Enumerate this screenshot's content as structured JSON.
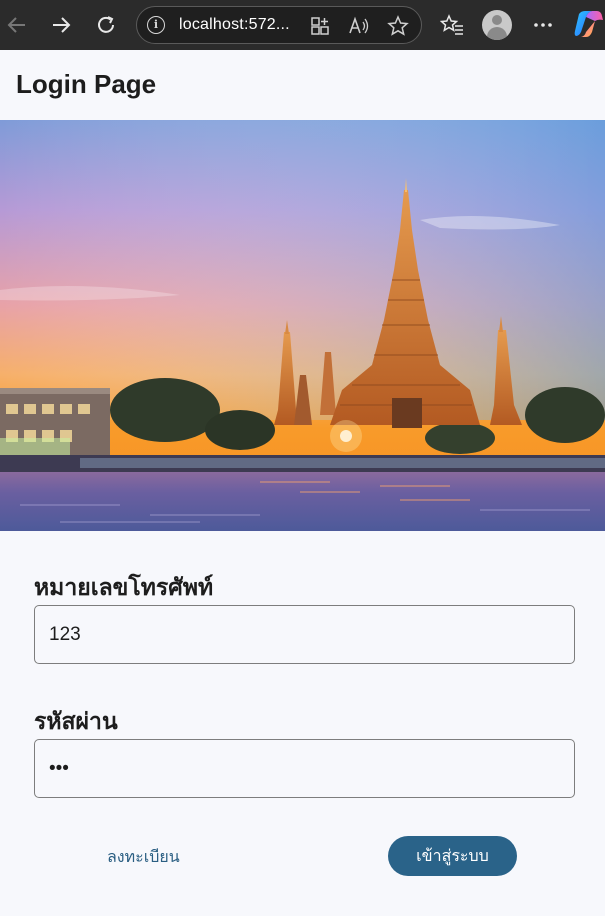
{
  "browser": {
    "url": "localhost:572...",
    "icons": [
      "back-icon",
      "forward-icon",
      "refresh-icon",
      "info-icon",
      "app-available-icon",
      "read-aloud-icon",
      "favorite-star-icon",
      "favorites-icon",
      "profile-avatar",
      "more-icon",
      "copilot-icon"
    ]
  },
  "app": {
    "title": "Login Page"
  },
  "hero": {
    "image": "wat-arun-temple-sunset-photo"
  },
  "form": {
    "phone_label": "หมายเลขโทรศัพท์",
    "phone_value": "123",
    "password_label": "รหัสผ่าน",
    "password_value": "•••",
    "register_label": "ลงทะเบียน",
    "login_label": "เข้าสู่ระบบ"
  },
  "colors": {
    "accent": "#2a6389",
    "link": "#2a5e82",
    "background": "#f7f8fc"
  }
}
